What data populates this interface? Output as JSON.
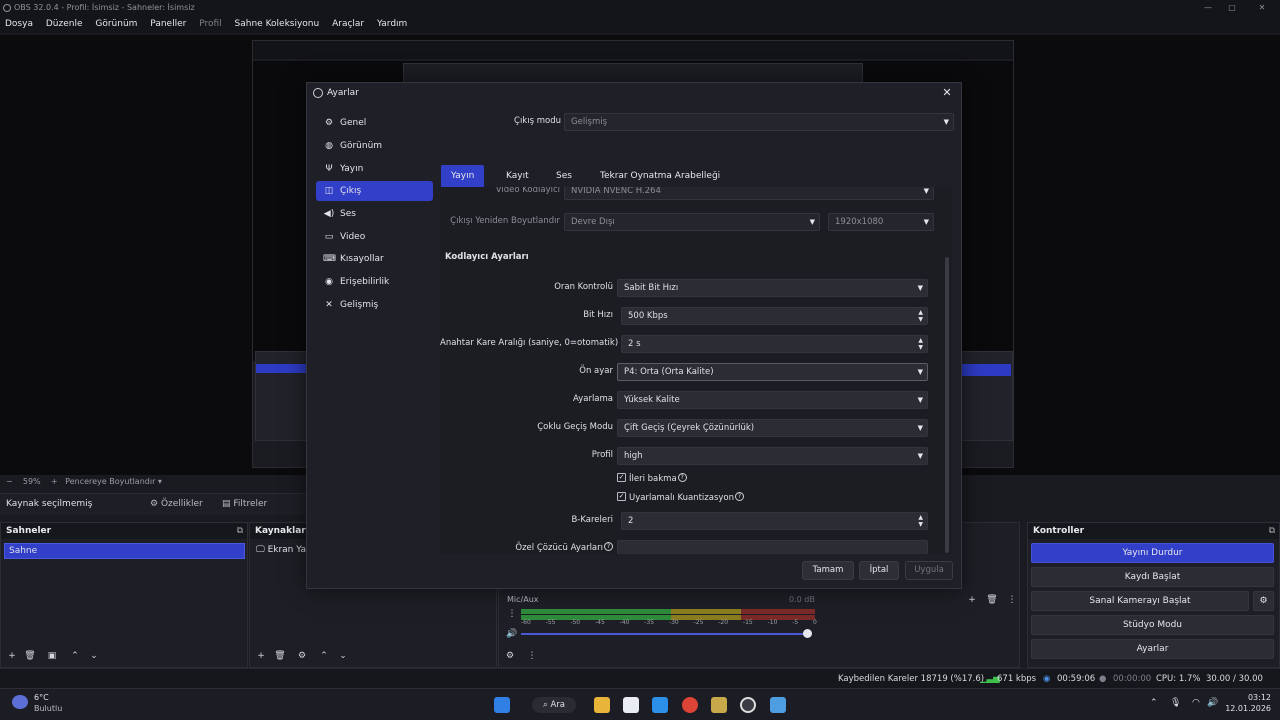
{
  "window": {
    "title": "OBS 32.0.4 - Profil: İsimsiz - Sahneler: İsimsiz"
  },
  "menu": [
    "Dosya",
    "Düzenle",
    "Görünüm",
    "Paneller",
    "Profil",
    "Sahne Koleksiyonu",
    "Araçlar",
    "Yardım"
  ],
  "zoom": {
    "value": "59%",
    "resize_label": "Pencereye Boyutlandır"
  },
  "source_bar": {
    "no_source": "Kaynak seçilmemiş",
    "properties": "Özellikler",
    "filters": "Filtreler"
  },
  "scenes": {
    "title": "Sahneler",
    "items": [
      "Sahne"
    ]
  },
  "sources": {
    "title": "Kaynaklar",
    "items": [
      "Ekran Ya"
    ]
  },
  "mixer": {
    "channel": "Mic/Aux",
    "db": "0.0 dB",
    "ticks": [
      "-60",
      "-55",
      "-50",
      "-45",
      "-40",
      "-35",
      "-30",
      "-25",
      "-20",
      "-15",
      "-10",
      "-5",
      "0"
    ]
  },
  "controls": {
    "title": "Kontroller",
    "buttons": [
      "Yayını Durdur",
      "Kaydı Başlat",
      "Sanal Kamerayı Başlat",
      "Stüdyo Modu",
      "Ayarlar"
    ]
  },
  "status": {
    "dropped": "Kaybedilen Kareler 18719 (%17.6)",
    "bitrate": "671 kbps",
    "stream_time": "00:59:06",
    "rec_time": "00:00:00",
    "cpu": "CPU: 1.7%",
    "fps": "30.00 / 30.00 FPS"
  },
  "taskbar": {
    "weather_temp": "6°C",
    "weather_desc": "Bulutlu",
    "search": "Ara",
    "time": "03:12",
    "date": "12.01.2026"
  },
  "dialog": {
    "title": "Ayarlar",
    "sidebar": [
      "Genel",
      "Görünüm",
      "Yayın",
      "Çıkış",
      "Ses",
      "Video",
      "Kısayollar",
      "Erişebilirlik",
      "Gelişmiş"
    ],
    "output_mode_label": "Çıkış modu",
    "output_mode_value": "Gelişmiş",
    "tabs": [
      "Yayın",
      "Kayıt",
      "Ses",
      "Tekrar Oynatma Arabelleği"
    ],
    "video_encoder_label": "Video Kodlayıcı",
    "video_encoder_value": "NVIDIA NVENC H.264",
    "rescale_label": "Çıkışı Yeniden Boyutlandır",
    "rescale_value": "Devre Dışı",
    "rescale_res": "1920x1080",
    "section_title": "Kodlayıcı Ayarları",
    "fields": {
      "rate_control_label": "Oran Kontrolü",
      "rate_control_value": "Sabit Bit Hızı",
      "bitrate_label": "Bit Hızı",
      "bitrate_value": "500 Kbps",
      "keyframe_label": "Anahtar Kare Aralığı (saniye, 0=otomatik)",
      "keyframe_value": "2 s",
      "preset_label": "Ön ayar",
      "preset_value": "P4: Orta (Orta Kalite)",
      "tuning_label": "Ayarlama",
      "tuning_value": "Yüksek Kalite",
      "multipass_label": "Çoklu Geçiş Modu",
      "multipass_value": "Çift Geçiş (Çeyrek Çözünürlük)",
      "profile_label": "Profil",
      "profile_value": "high",
      "lookahead_label": "İleri bakma",
      "aq_label": "Uyarlamalı Kuantizasyon",
      "bframes_label": "B-Kareleri",
      "bframes_value": "2",
      "custom_label": "Özel Çözücü Ayarları"
    },
    "buttons": {
      "ok": "Tamam",
      "cancel": "İptal",
      "apply": "Uygula"
    }
  },
  "colors": {
    "accent": "#3240c9",
    "bg": "#1f2027"
  }
}
